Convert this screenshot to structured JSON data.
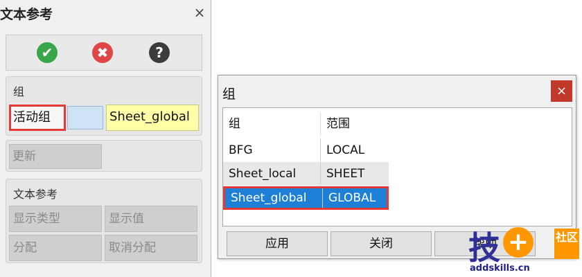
{
  "left_panel": {
    "title": "文本参考",
    "close_label": "×",
    "toolbar": {
      "ok_glyph": "✔",
      "cancel_glyph": "✖",
      "help_glyph": "?"
    },
    "group_section": {
      "title": "组",
      "active_group_label": "活动组",
      "active_group_value": "Sheet_global"
    },
    "update_label": "更新",
    "textref_section": {
      "title": "文本参考",
      "display_type_label": "显示类型",
      "display_value_label": "显示值",
      "assign_label": "分配",
      "unassign_label": "取消分配"
    }
  },
  "dialog": {
    "title": "组",
    "close_label": "×",
    "table": {
      "headers": [
        "组",
        "范围"
      ],
      "rows": [
        [
          "BFG",
          "LOCAL"
        ],
        [
          "Sheet_local",
          "SHEET"
        ],
        [
          "Sheet_global",
          "GLOBAL"
        ]
      ]
    },
    "buttons": {
      "apply": "应用",
      "close": "关闭",
      "help": "帮助"
    }
  },
  "watermark": {
    "big": "技",
    "plus": "+",
    "box": "社区",
    "domain": "addskills.cn"
  },
  "colors": {
    "selection": "#1e7fd6",
    "highlight_border": "#e53935",
    "active_value_bg": "#ffffa8"
  }
}
